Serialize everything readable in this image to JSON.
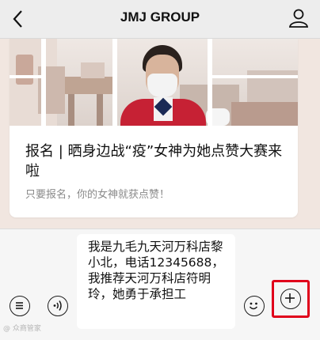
{
  "header": {
    "title": "JMJ GROUP",
    "back_icon": "chevron-left-icon",
    "user_icon": "person-icon"
  },
  "article_card": {
    "headline": "报名 | 晒身边战“疫”女神为她点赞大赛来啦",
    "description": "只要报名，你的女神就获点赞！"
  },
  "input_bar": {
    "message_text": "我是九毛九天河万科店黎小北，电话12345688，\n我推荐天河万科店符明玲，她勇于承担工",
    "left_icons": [
      "list-icon",
      "voice-icon"
    ],
    "right_icons": [
      "emoji-icon",
      "plus-icon"
    ]
  },
  "watermark": "@ 众商管家",
  "colors": {
    "highlight": "#e0001b",
    "uniform": "#c62134"
  }
}
